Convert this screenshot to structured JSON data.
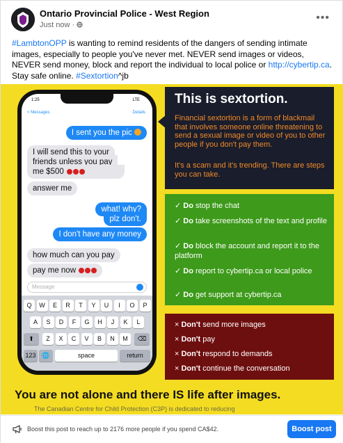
{
  "post": {
    "page_name": "Ontario Provincial Police - West Region",
    "timestamp": "Just now",
    "visibility_icon": "globe-icon",
    "more_label": "•••",
    "text": {
      "hashtag1": "#LambtonOPP",
      "body1": " is wanting to remind residents of the dangers of sending intimate images, especially to people you've never met. NEVER send images or videos, NEVER send money, block and report the individual to local police or ",
      "link": "http://cybertip.ca",
      "body2": ". Stay safe online. ",
      "hashtag2": "#Sextortion",
      "signoff": "^jb"
    }
  },
  "image": {
    "phone": {
      "time": "1:25",
      "signal": "LTE",
      "back_label": "< Messages",
      "details_label": "Details",
      "messages": [
        {
          "from": "out",
          "text": "I sent you the pic"
        },
        {
          "from": "in",
          "text": "I will send this to your"
        },
        {
          "from": "in",
          "text": "friends unless you pay"
        },
        {
          "from": "in",
          "text": "me $500"
        },
        {
          "from": "in",
          "text": "answer me"
        },
        {
          "from": "out",
          "text": "what! why?"
        },
        {
          "from": "out",
          "text": "plz don't."
        },
        {
          "from": "out",
          "text": "I don't have any money"
        },
        {
          "from": "in",
          "text": "how much can you pay"
        },
        {
          "from": "in",
          "text": "pay me now"
        }
      ],
      "input_placeholder": "Message",
      "keyboard": {
        "row1": [
          "Q",
          "W",
          "E",
          "R",
          "T",
          "Y",
          "U",
          "I",
          "O",
          "P"
        ],
        "row2": [
          "A",
          "S",
          "D",
          "F",
          "G",
          "H",
          "J",
          "K",
          "L"
        ],
        "row3": [
          "Z",
          "X",
          "C",
          "V",
          "B",
          "N",
          "M"
        ],
        "numbers_key": "123",
        "space_key": "space",
        "return_key": "return"
      }
    },
    "info": {
      "title": "This is sextortion.",
      "paragraph1": "Financial sextortion is a form of blackmail that involves someone online threatening to send a sexual image or video of you to other people if you don't pay them.",
      "paragraph2": "It's a scam and it's trending. There are steps you can take."
    },
    "dos": [
      {
        "strong": "Do",
        "text": " stop the chat"
      },
      {
        "strong": "Do",
        "text": " take screenshots of the text and profile"
      },
      {
        "strong": "Do",
        "text": " block the account and report it to the platform"
      },
      {
        "strong": "Do",
        "text": " report to cybertip.ca or local police"
      },
      {
        "strong": "Do",
        "text": " get support at cybertip.ca"
      }
    ],
    "donts": [
      {
        "strong": "Don't",
        "text": " send more images"
      },
      {
        "strong": "Don't",
        "text": " pay"
      },
      {
        "strong": "Don't",
        "text": " respond to demands"
      },
      {
        "strong": "Don't",
        "text": " continue the conversation"
      }
    ],
    "headline": "You are not alone and there IS life after images.",
    "subline": "The Canadian Centre for Child Protection (C3P) is dedicated to reducing"
  },
  "boost": {
    "text": "Boost this post to reach up to 2176 more people if you spend CA$42.",
    "button_label": "Boost post"
  },
  "colors": {
    "image_bg": "#f4dc22",
    "dark_panel": "#1a1d2b",
    "green_panel": "#3d9a1a",
    "red_panel": "#6e0f0f",
    "accent_orange": "#f08a2a",
    "facebook_blue": "#1877f2"
  }
}
